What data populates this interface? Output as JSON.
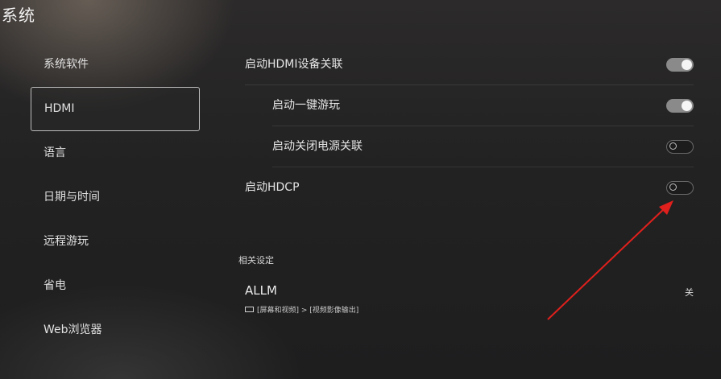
{
  "page": {
    "title": "系统"
  },
  "sidebar": {
    "items": [
      {
        "label": "系统软件"
      },
      {
        "label": "HDMI"
      },
      {
        "label": "语言"
      },
      {
        "label": "日期与时间"
      },
      {
        "label": "远程游玩"
      },
      {
        "label": "省电"
      },
      {
        "label": "Web浏览器"
      }
    ],
    "selected": "HDMI"
  },
  "settings": {
    "rows": [
      {
        "label": "启动HDMI设备关联",
        "state": "on"
      },
      {
        "label": "启动一键游玩",
        "state": "on"
      },
      {
        "label": "启动关闭电源关联",
        "state": "off"
      },
      {
        "label": "启动HDCP",
        "state": "off"
      }
    ]
  },
  "related": {
    "section_label": "相关设定",
    "allm": {
      "title": "ALLM",
      "value": "关",
      "path_icon": "screen-icon",
      "path": "[屏幕和视频] > [视频影像输出]"
    }
  },
  "colors": {
    "annotation_arrow": "#e0201c",
    "toggle_on": "#8a8a8a",
    "toggle_off_border": "#6a6a6a"
  }
}
